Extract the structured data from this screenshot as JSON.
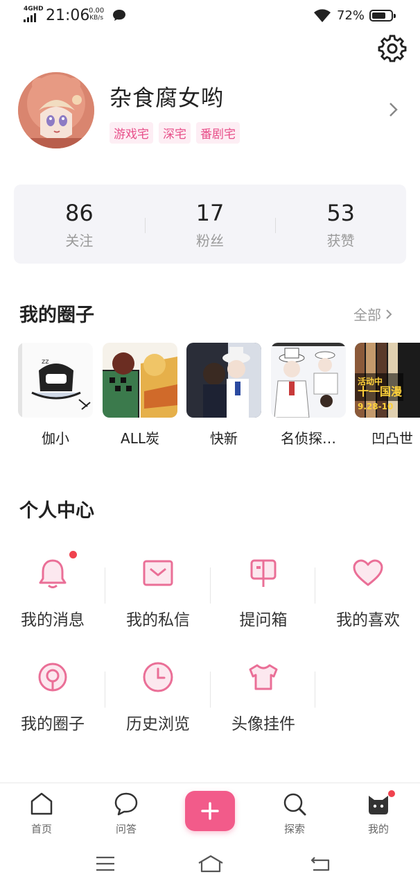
{
  "status_bar": {
    "network": "4GHD",
    "time": "21:06",
    "speed_value": "0.00",
    "speed_unit": "KB/s",
    "battery": "72%",
    "battery_level": 0.72
  },
  "profile": {
    "name": "杂食腐女哟",
    "tags": [
      "游戏宅",
      "深宅",
      "番剧宅"
    ]
  },
  "stats": [
    {
      "value": "86",
      "label": "关注"
    },
    {
      "value": "17",
      "label": "粉丝"
    },
    {
      "value": "53",
      "label": "获赞"
    }
  ],
  "circles": {
    "title": "我的圈子",
    "all_label": "全部",
    "items": [
      {
        "name": "伽小"
      },
      {
        "name": "ALL炭"
      },
      {
        "name": "快新"
      },
      {
        "name": "名侦探…"
      },
      {
        "name": "凹凸世",
        "thumb_text": "活动中",
        "thumb_text2": "十一国漫",
        "thumb_text3": "9.28-10"
      }
    ]
  },
  "personal_center": {
    "title": "个人中心",
    "items": [
      {
        "label": "我的消息",
        "icon": "bell-icon"
      },
      {
        "label": "我的私信",
        "icon": "envelope-icon"
      },
      {
        "label": "提问箱",
        "icon": "mailbox-icon"
      },
      {
        "label": "我的喜欢",
        "icon": "heart-icon"
      },
      {
        "label": "我的圈子",
        "icon": "circle-icon"
      },
      {
        "label": "历史浏览",
        "icon": "clock-icon"
      },
      {
        "label": "头像挂件",
        "icon": "shirt-icon"
      }
    ]
  },
  "tabbar": {
    "items": [
      {
        "label": "首页",
        "icon": "home-icon"
      },
      {
        "label": "问答",
        "icon": "chat-bubble-icon"
      },
      {
        "label": "探索",
        "icon": "search-icon"
      },
      {
        "label": "我的",
        "icon": "cat-face-icon"
      }
    ],
    "center_icon": "plus-icon"
  },
  "colors": {
    "accent": "#f25b8a",
    "tag_bg": "#fdeef4",
    "tag_text": "#e8508a",
    "badge": "#f0424e"
  }
}
